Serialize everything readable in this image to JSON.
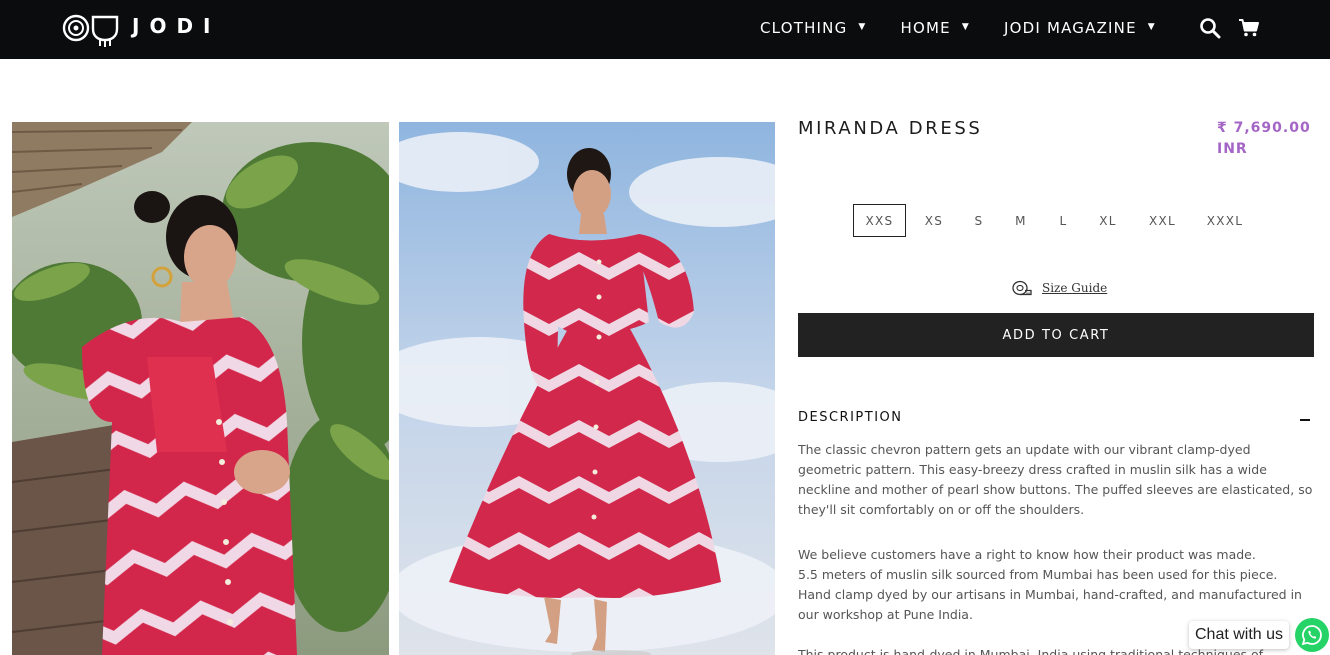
{
  "brand": {
    "name": "JODI"
  },
  "nav": {
    "items": [
      {
        "label": "CLOTHING"
      },
      {
        "label": "HOME"
      },
      {
        "label": "JODI MAGAZINE"
      }
    ],
    "icons": [
      "search-icon",
      "cart-icon"
    ]
  },
  "product": {
    "title": "MIRANDA DRESS",
    "price_line1": "₹ 7,690.00",
    "price_line2": "INR",
    "sizes": [
      "XXS",
      "XS",
      "S",
      "M",
      "L",
      "XL",
      "XXL",
      "XXXL"
    ],
    "selected_size": "XXS",
    "size_guide_label": "Size Guide",
    "add_to_cart_label": "ADD TO CART"
  },
  "description": {
    "heading": "DESCRIPTION",
    "p1": "The classic chevron pattern gets an update with our vibrant clamp-dyed geometric pattern. This easy-breezy dress crafted in muslin silk has a wide neckline and mother of pearl show buttons. The puffed sleeves are elasticated, so they'll sit comfortably on or off the shoulders.",
    "p2_lines": [
      "We believe customers have a right to know how their product was made.",
      "5.5 meters of muslin silk sourced from Mumbai has been used for this piece.",
      "Hand clamp dyed by our artisans in Mumbai, hand-crafted, and manufactured in our workshop at Pune India."
    ],
    "p3": "This product is hand-dyed in Mumbai, India using traditional techniques of"
  },
  "chat": {
    "label": "Chat with us"
  },
  "colors": {
    "header_bg": "#0a0c0d",
    "price": "#a466c6",
    "button_bg": "#222222",
    "whatsapp": "#25d366"
  }
}
